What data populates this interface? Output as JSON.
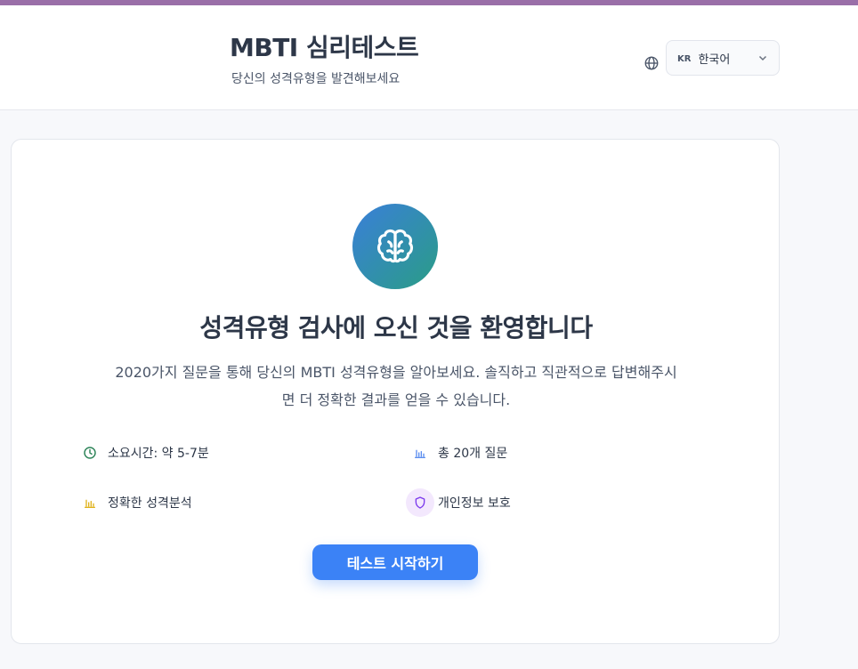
{
  "header": {
    "title": "MBTI 심리테스트",
    "subtitle": "당신의 성격유형을 발견해보세요",
    "language": {
      "code": "KR",
      "label": "한국어"
    }
  },
  "main": {
    "welcome_title": "성격유형 검사에 오신 것을 환영합니다",
    "description_line1": "2020가지 질문을 통해 당신의 MBTI 성격유형을 알아보세요. 솔직하고 직관적으로 답변해주시",
    "description_line2": "면 더 정확한 결과를 얻을 수 있습니다.",
    "features": [
      {
        "icon": "clock-icon",
        "label": "소요시간: 약 5-7분",
        "color": "#2f855a"
      },
      {
        "icon": "bar-chart-icon",
        "label": "총 20개 질문",
        "color": "#5b8def"
      },
      {
        "icon": "bar-chart-icon",
        "label": "정확한 성격분석",
        "color": "#e0b21b"
      },
      {
        "icon": "shield-icon",
        "label": "개인정보 보호",
        "color": "#7c3aed"
      }
    ],
    "start_button": "테스트 시작하기"
  },
  "colors": {
    "accent": "#3b82f6",
    "top_bar": "#9a6fa8",
    "brain_gradient_start": "#3a7fd9",
    "brain_gradient_end": "#2a9d86"
  }
}
